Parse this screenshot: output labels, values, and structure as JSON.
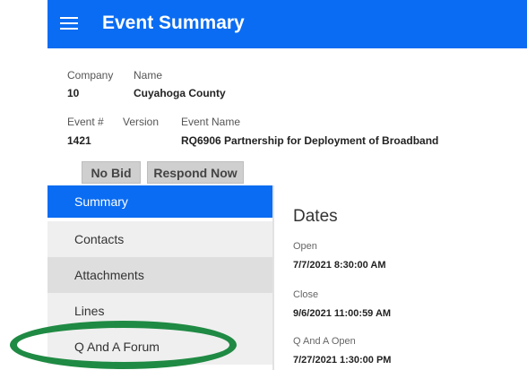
{
  "header": {
    "title": "Event Summary"
  },
  "company": {
    "company_label": "Company",
    "name_label": "Name",
    "company_value": "10",
    "name_value": "Cuyahoga County"
  },
  "event": {
    "number_label": "Event #",
    "version_label": "Version",
    "name_label": "Event Name",
    "number_value": "1421",
    "name_value": "RQ6906 Partnership for Deployment of Broadband"
  },
  "actions": {
    "no_bid": "No Bid",
    "respond_now": "Respond Now"
  },
  "sidebar": {
    "items": [
      {
        "label": "Summary",
        "active": true
      },
      {
        "label": "Contacts"
      },
      {
        "label": "Attachments"
      },
      {
        "label": "Lines"
      },
      {
        "label": "Q And A Forum"
      }
    ]
  },
  "dates": {
    "title": "Dates",
    "items": [
      {
        "label": "Open",
        "value": "7/7/2021 8:30:00 AM"
      },
      {
        "label": "Close",
        "value": "9/6/2021 11:00:59 AM"
      },
      {
        "label": "Q And A Open",
        "value": "7/27/2021 1:30:00 PM"
      }
    ]
  },
  "colors": {
    "brand": "#0a6cf2",
    "highlight": "#1f8a43"
  }
}
